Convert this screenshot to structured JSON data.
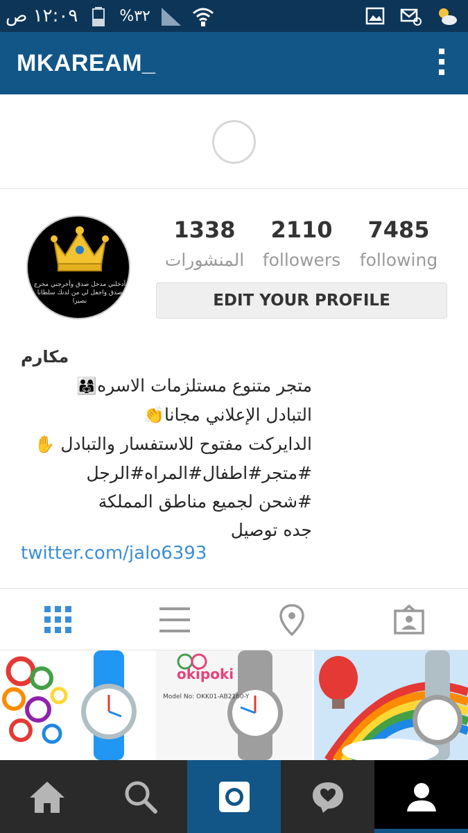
{
  "status_bar": {
    "time": "١٢:٠٩ ص",
    "battery_percent": "%٣٢",
    "icons": [
      "signal-icon",
      "battery-icon",
      "wifi-icon",
      "gallery-icon",
      "email-notification-icon",
      "weather-icon"
    ]
  },
  "app_bar": {
    "title": "MKAREAM_",
    "menu_icon": "overflow-menu-icon"
  },
  "profile": {
    "avatar_text": "أدخلني مدخل صدق وأخرجني مخرج صدق واجعل لي من لدنك سلطانا نصيرا",
    "stats": {
      "posts_count": "1338",
      "posts_label": "المنشورات",
      "followers_count": "2110",
      "followers_label": "followers",
      "following_count": "7485",
      "following_label": "following"
    },
    "edit_button": "EDIT YOUR PROFILE",
    "name": "مكارم",
    "bio_lines": [
      "متجر متنوع مستلزمات الاسره",
      "التبادل الإعلاني مجانا",
      "الدايركت مفتوح للاستفسار والتبادل",
      "#متجر#اطفال#المراه#الرجل",
      "#شحن لجميع مناطق المملكة",
      "جده توصيل"
    ],
    "bio_emojis": [
      "👨‍👩‍👧",
      "👏",
      "✋"
    ],
    "link": "twitter.com/jalo6393"
  },
  "tabs": [
    "grid-icon",
    "list-icon",
    "location-icon",
    "tagged-icon"
  ],
  "grid": {
    "photo2_brand": "okipoki",
    "photo2_model": "Model No: OKK01-AB2160-Y"
  },
  "bottom_nav": [
    "home-icon",
    "search-icon",
    "camera-icon",
    "activity-icon",
    "profile-icon"
  ],
  "colors": {
    "app_bar": "#125688",
    "status_bar": "#0d3558",
    "link": "#3b8ed6",
    "bottom_nav": "#2a2a2a"
  }
}
